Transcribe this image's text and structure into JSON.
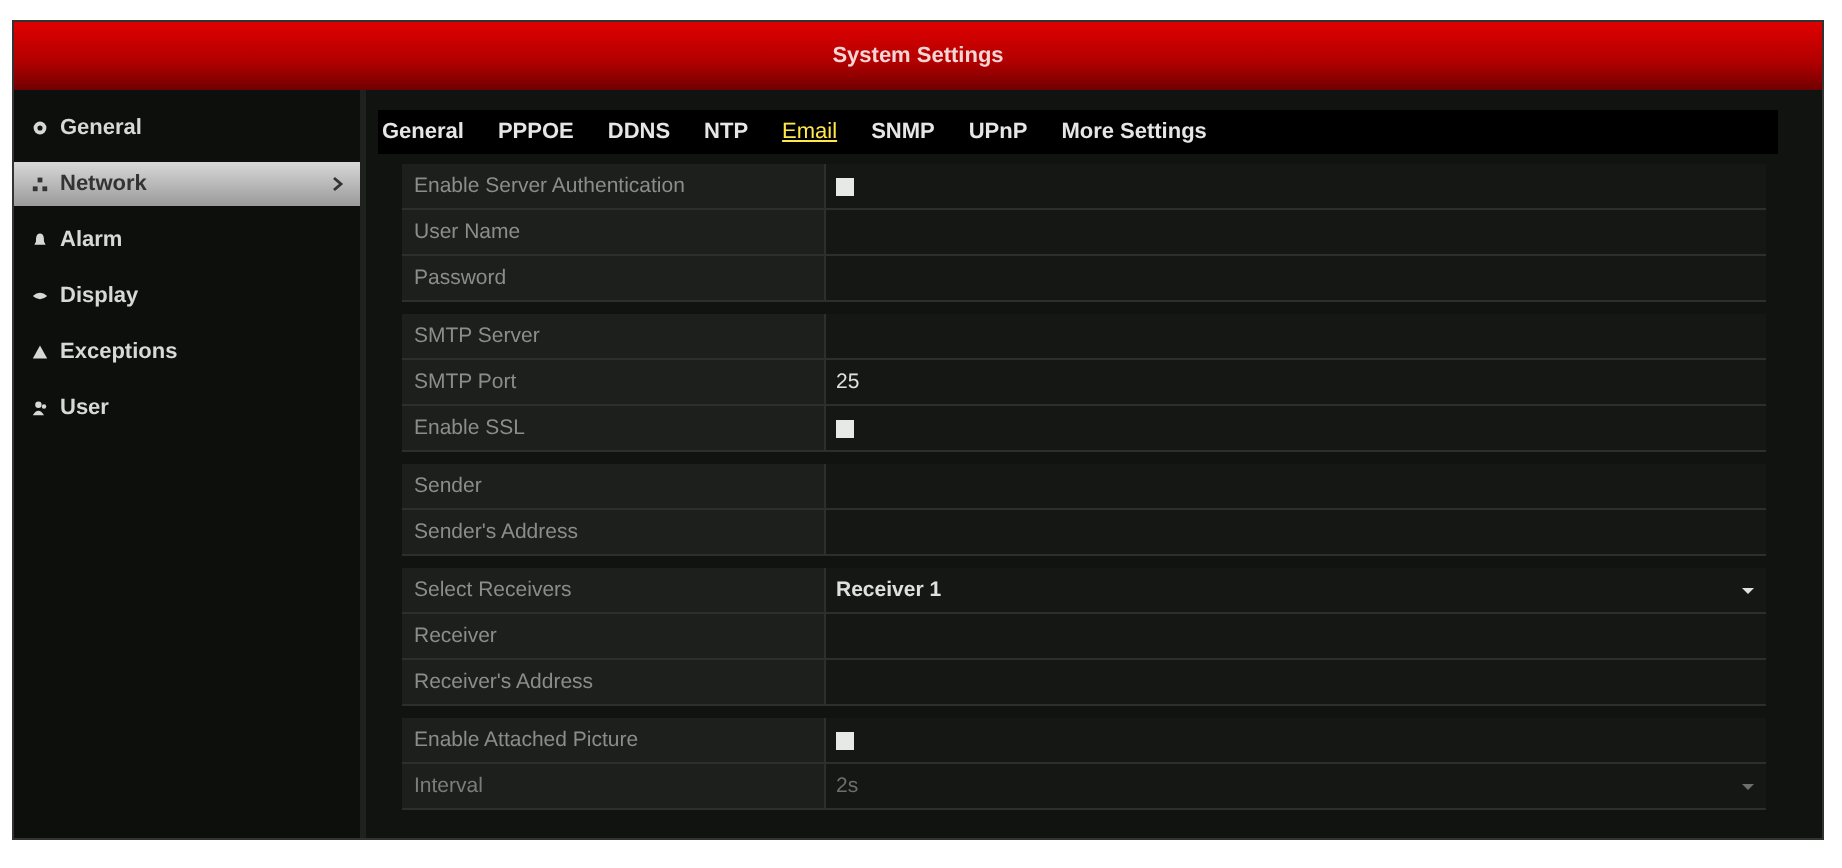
{
  "window": {
    "title": "System Settings"
  },
  "sidebar": {
    "items": [
      {
        "label": "General",
        "kind": "gear",
        "selected": false
      },
      {
        "label": "Network",
        "kind": "network",
        "selected": true
      },
      {
        "label": "Alarm",
        "kind": "bell",
        "selected": false
      },
      {
        "label": "Display",
        "kind": "eye",
        "selected": false
      },
      {
        "label": "Exceptions",
        "kind": "warning",
        "selected": false
      },
      {
        "label": "User",
        "kind": "user",
        "selected": false
      }
    ]
  },
  "tabs": [
    {
      "label": "General",
      "selected": false
    },
    {
      "label": "PPPOE",
      "selected": false
    },
    {
      "label": "DDNS",
      "selected": false
    },
    {
      "label": "NTP",
      "selected": false
    },
    {
      "label": "Email",
      "selected": true
    },
    {
      "label": "SNMP",
      "selected": false
    },
    {
      "label": "UPnP",
      "selected": false
    },
    {
      "label": "More Settings",
      "selected": false
    }
  ],
  "groups": [
    {
      "rows": [
        {
          "label": "Enable Server Authentication",
          "kind": "checkbox",
          "checked": false
        },
        {
          "label": "User Name",
          "kind": "text"
        },
        {
          "label": "Password",
          "kind": "text"
        }
      ]
    },
    {
      "rows": [
        {
          "label": "SMTP Server",
          "kind": "text"
        },
        {
          "label": "SMTP Port",
          "kind": "text",
          "value": "25"
        },
        {
          "label": "Enable SSL",
          "kind": "checkbox",
          "checked": false
        }
      ]
    },
    {
      "rows": [
        {
          "label": "Sender",
          "kind": "text"
        },
        {
          "label": "Sender's Address",
          "kind": "text"
        }
      ]
    },
    {
      "rows": [
        {
          "label": "Select Receivers",
          "kind": "dropdown",
          "value": "Receiver 1",
          "disabled": false
        },
        {
          "label": "Receiver",
          "kind": "text"
        },
        {
          "label": "Receiver's Address",
          "kind": "text"
        }
      ]
    },
    {
      "rows": [
        {
          "label": "Enable Attached Picture",
          "kind": "checkbox",
          "checked": false
        },
        {
          "label": "Interval",
          "kind": "dropdown",
          "value": "2s",
          "disabled": true
        }
      ]
    }
  ]
}
